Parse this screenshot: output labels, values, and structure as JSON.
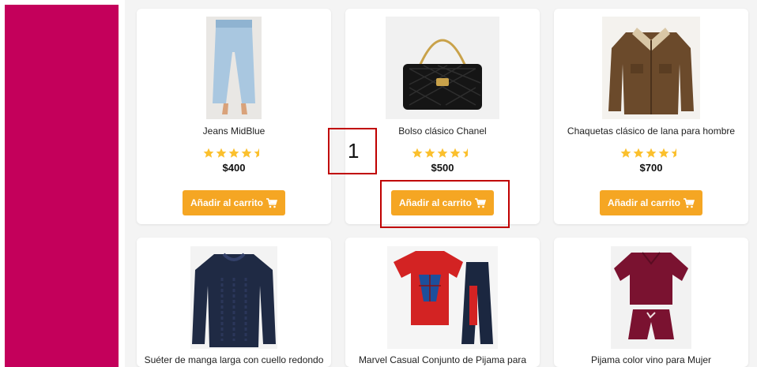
{
  "colors": {
    "sidebar": "#c4005b",
    "button": "#f5a623",
    "star": "#fbc02d",
    "annotation": "#c00000"
  },
  "products": [
    {
      "name": "Jeans MidBlue",
      "price": "$400",
      "rating": 4.5,
      "button_label": "Añadir al carrito",
      "image": "jeans-image"
    },
    {
      "name": "Bolso clásico Chanel",
      "price": "$500",
      "rating": 4.5,
      "button_label": "Añadir al carrito",
      "image": "handbag-image"
    },
    {
      "name": "Chaquetas clásico de lana para hombre",
      "price": "$700",
      "rating": 4.5,
      "button_label": "Añadir al carrito",
      "image": "jacket-image"
    },
    {
      "name": "Suéter de manga larga con cuello redondo",
      "image": "sweater-image"
    },
    {
      "name": "Marvel Casual Conjunto de Pijama para",
      "image": "pajama-image"
    },
    {
      "name": "Pijama color vino para Mujer",
      "image": "womens-pajama-image"
    }
  ],
  "annotations": [
    {
      "label": "1"
    }
  ],
  "icons": {
    "cart": "cart-icon",
    "star": "star-icon"
  }
}
